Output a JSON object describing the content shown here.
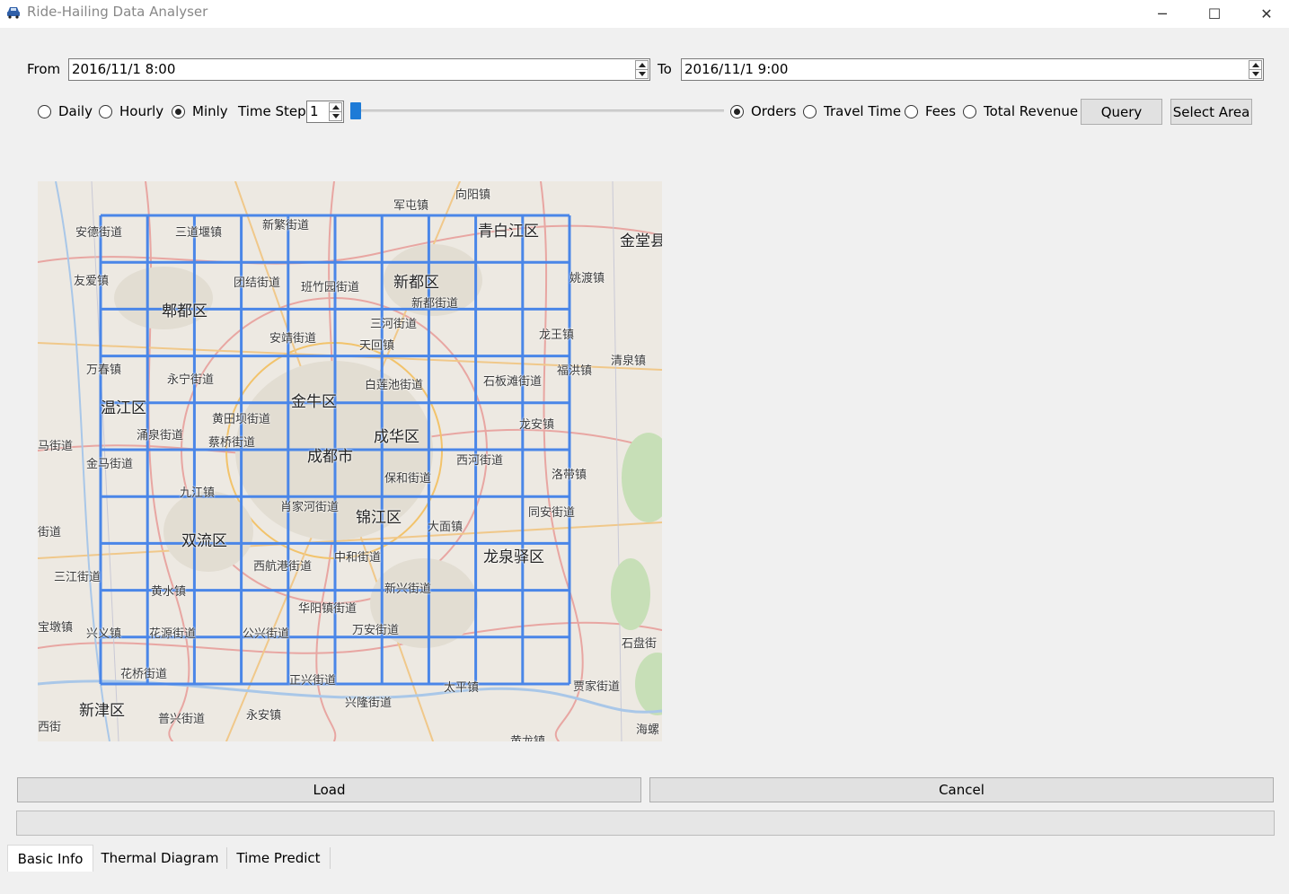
{
  "window": {
    "title": "Ride-Hailing Data Analyser",
    "minimize_glyph": "─",
    "maximize_glyph": "☐",
    "close_glyph": "✕"
  },
  "range": {
    "from_label": "From",
    "from_value": "2016/11/1 8:00",
    "to_label": "To",
    "to_value": "2016/11/1 9:00"
  },
  "granularity": {
    "options": [
      "Daily",
      "Hourly",
      "Minly"
    ],
    "selected": "Minly",
    "time_step_label": "Time Step",
    "time_step_value": "1",
    "slider_position": 0
  },
  "metric": {
    "options": [
      "Orders",
      "Travel Time",
      "Fees",
      "Total Revenue"
    ],
    "selected": "Orders"
  },
  "buttons": {
    "query": "Query",
    "select_area": "Select Area",
    "load": "Load",
    "cancel": "Cancel"
  },
  "progress": {
    "value": 0
  },
  "map": {
    "grid_color": "#4a86e8",
    "grid_cols": 10,
    "grid_rows": 10,
    "labels": [
      "向阳镇",
      "军屯镇",
      "新繁街道",
      "青白江区",
      "金堂县",
      "安德街道",
      "三道堰镇",
      "友爱镇",
      "团结街道",
      "班竹园街道",
      "新都区",
      "新都街道",
      "姚渡镇",
      "郫都区",
      "三河街道",
      "龙王镇",
      "安靖街道",
      "天回镇",
      "清泉镇",
      "万春镇",
      "永宁街道",
      "白莲池街道",
      "石板滩街道",
      "福洪镇",
      "温江区",
      "金牛区",
      "黄田坝街道",
      "涌泉街道",
      "蔡桥街道",
      "成华区",
      "龙安镇",
      "马街道",
      "金马街道",
      "成都市",
      "保和街道",
      "西河街道",
      "洛带镇",
      "九江镇",
      "肖家河街道",
      "锦江区",
      "大面镇",
      "同安街道",
      "街道",
      "双流区",
      "西航港街道",
      "中和街道",
      "龙泉驿区",
      "三江街道",
      "黄水镇",
      "新兴街道",
      "华阳镇街道",
      "宝墩镇",
      "兴义镇",
      "花源街道",
      "公兴街道",
      "万安街道",
      "石盘街",
      "花桥街道",
      "正兴街道",
      "太平镇",
      "贾家街道",
      "新津区",
      "兴隆街道",
      "普兴街道",
      "永安镇",
      "海螺",
      "西街",
      "黄龙镇"
    ]
  },
  "tabs": {
    "items": [
      "Basic Info",
      "Thermal Diagram",
      "Time Predict"
    ],
    "active": "Basic Info"
  }
}
